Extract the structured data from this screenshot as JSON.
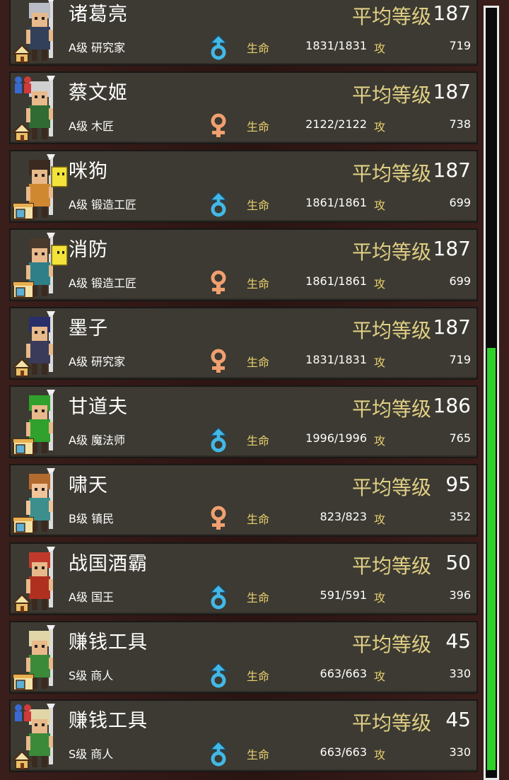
{
  "labels": {
    "avg_level": "平均等级",
    "hp": "生命",
    "atk": "攻"
  },
  "colors": {
    "male": "#42b8e6",
    "female": "#f0a070",
    "gold": "#e0cf85",
    "scroll": "#2ed12b"
  },
  "scroll": {
    "position_fraction": 0.45
  },
  "characters": [
    {
      "name": "诸葛亮",
      "rank": "A级 研究家",
      "gender": "male",
      "gender_icon": "male-symbol-icon",
      "level": "187",
      "hp": "1831/1831",
      "atk": "719",
      "hair": "#b9bcc4",
      "skin": "#e8b98a",
      "cloth": "#33405a",
      "house": "house-icon"
    },
    {
      "name": "蔡文姬",
      "rank": "A级 木匠",
      "gender": "female",
      "gender_icon": "female-symbol-icon",
      "level": "187",
      "hp": "2122/2122",
      "atk": "738",
      "hair": "#d0d0d0",
      "skin": "#e8b98a",
      "cloth": "#2f6b33",
      "house": "house-icon",
      "team": true
    },
    {
      "name": "咪狗",
      "rank": "A级 锻造工匠",
      "gender": "male",
      "gender_icon": "male-symbol-icon",
      "level": "187",
      "hp": "1861/1861",
      "atk": "699",
      "hair": "#3b2a20",
      "skin": "#e8b98a",
      "cloth": "#d08830",
      "house": "shop-icon",
      "flag": true
    },
    {
      "name": "消防",
      "rank": "A级 锻造工匠",
      "gender": "female",
      "gender_icon": "female-symbol-icon",
      "level": "187",
      "hp": "1861/1861",
      "atk": "699",
      "hair": "#4a3a2e",
      "skin": "#e8b98a",
      "cloth": "#2f7f88",
      "house": "shop-icon",
      "flag": true
    },
    {
      "name": "墨子",
      "rank": "A级 研究家",
      "gender": "female",
      "gender_icon": "female-symbol-icon",
      "level": "187",
      "hp": "1831/1831",
      "atk": "719",
      "hair": "#2a2f6a",
      "skin": "#e8b98a",
      "cloth": "#3a3a5a",
      "house": "house-icon"
    },
    {
      "name": "甘道夫",
      "rank": "A级 魔法师",
      "gender": "male",
      "gender_icon": "male-symbol-icon",
      "level": "186",
      "hp": "1996/1996",
      "atk": "765",
      "hair": "#2fa12c",
      "skin": "#e8b98a",
      "cloth": "#2fa12c",
      "house": "shop-icon"
    },
    {
      "name": "啸天",
      "rank": "B级 镇民",
      "gender": "female",
      "gender_icon": "female-symbol-icon",
      "level": "95",
      "hp": "823/823",
      "atk": "352",
      "hair": "#b36a2e",
      "skin": "#f0c49a",
      "cloth": "#3d8f8e",
      "house": "shop-icon"
    },
    {
      "name": "战国酒霸",
      "rank": "A级 国王",
      "gender": "male",
      "gender_icon": "male-symbol-icon",
      "level": "50",
      "hp": "591/591",
      "atk": "396",
      "hair": "#c0392b",
      "skin": "#e8b98a",
      "cloth": "#b03020",
      "house": "house-icon"
    },
    {
      "name": "赚钱工具",
      "rank": "S级 商人",
      "gender": "male",
      "gender_icon": "male-symbol-icon",
      "level": "45",
      "hp": "663/663",
      "atk": "330",
      "hair": "#e0d6a8",
      "skin": "#e8b98a",
      "cloth": "#3a8a3a",
      "house": "shop-icon"
    },
    {
      "name": "赚钱工具",
      "rank": "S级 商人",
      "gender": "male",
      "gender_icon": "male-symbol-icon",
      "level": "45",
      "hp": "663/663",
      "atk": "330",
      "hair": "#e0d6a8",
      "skin": "#e8b98a",
      "cloth": "#3a8a3a",
      "house": "house-icon",
      "team": true
    }
  ]
}
